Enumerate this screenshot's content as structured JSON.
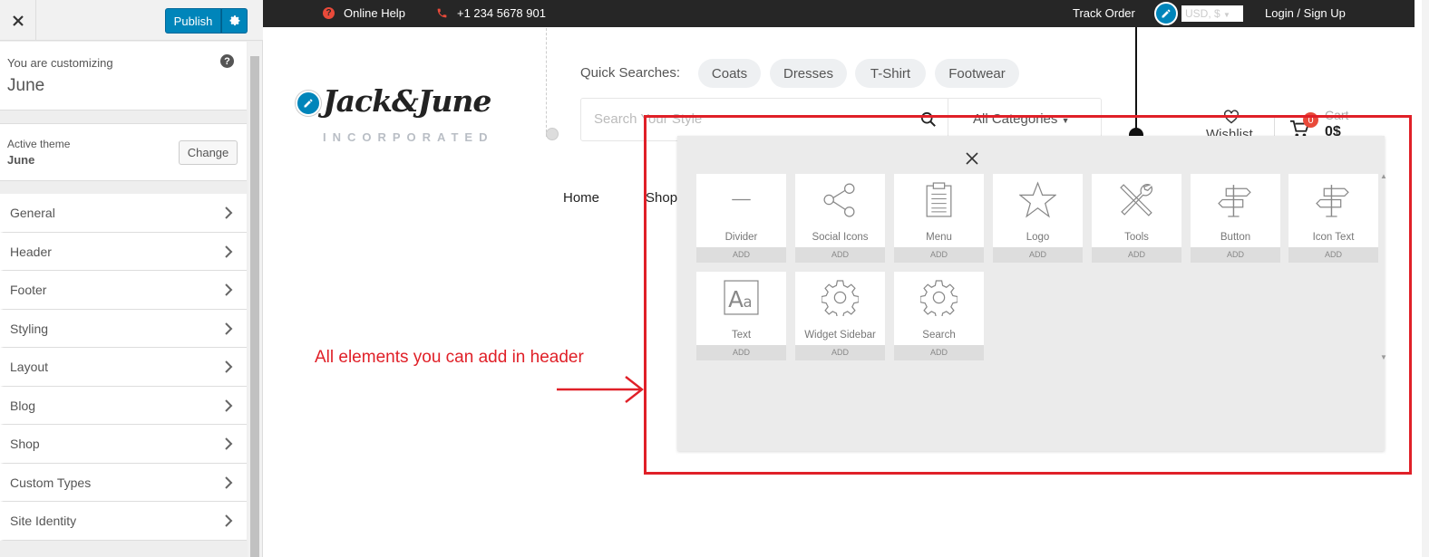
{
  "customizer": {
    "close_label": "Close",
    "publish_label": "Publish",
    "customizing_label": "You are customizing",
    "customizing_name": "June",
    "help_glyph": "?",
    "theme_label": "Active theme",
    "theme_name": "June",
    "change_label": "Change",
    "sections": [
      {
        "label": "General"
      },
      {
        "label": "Header"
      },
      {
        "label": "Footer"
      },
      {
        "label": "Styling"
      },
      {
        "label": "Layout"
      },
      {
        "label": "Blog"
      },
      {
        "label": "Shop"
      },
      {
        "label": "Custom Types"
      },
      {
        "label": "Site Identity"
      }
    ],
    "accent_color": "#0085ba"
  },
  "topbar": {
    "help_label": "Online Help",
    "phone": "+1 234 5678 901",
    "track_order": "Track Order",
    "currency": "USD, $",
    "login": "Login / Sign Up"
  },
  "brand": {
    "logo_text": "Jack&June",
    "logo_sub": "INCORPORATED"
  },
  "quick_searches": {
    "label": "Quick Searches:",
    "items": [
      "Coats",
      "Dresses",
      "T-Shirt",
      "Footwear"
    ]
  },
  "search": {
    "placeholder": "Search Your Style",
    "category": "All Categories"
  },
  "header_actions": {
    "wishlist": "Wishlist",
    "cart_label": "Cart",
    "cart_count": "0",
    "cart_total": "0$"
  },
  "nav": {
    "items": [
      "Home",
      "Shop"
    ]
  },
  "elements_panel": {
    "add_label": "ADD",
    "tiles": [
      {
        "name": "Divider",
        "icon": "divider-icon"
      },
      {
        "name": "Social Icons",
        "icon": "share-icon"
      },
      {
        "name": "Menu",
        "icon": "clipboard-icon"
      },
      {
        "name": "Logo",
        "icon": "star-icon"
      },
      {
        "name": "Tools",
        "icon": "tools-icon"
      },
      {
        "name": "Button",
        "icon": "signpost-icon"
      },
      {
        "name": "Icon Text",
        "icon": "signpost-icon"
      },
      {
        "name": "Text",
        "icon": "text-aa-icon"
      },
      {
        "name": "Widget Sidebar",
        "icon": "gear-icon"
      },
      {
        "name": "Search",
        "icon": "gear-icon"
      }
    ]
  },
  "annotation": {
    "text": "All elements you can add in header",
    "color": "#e02028"
  }
}
